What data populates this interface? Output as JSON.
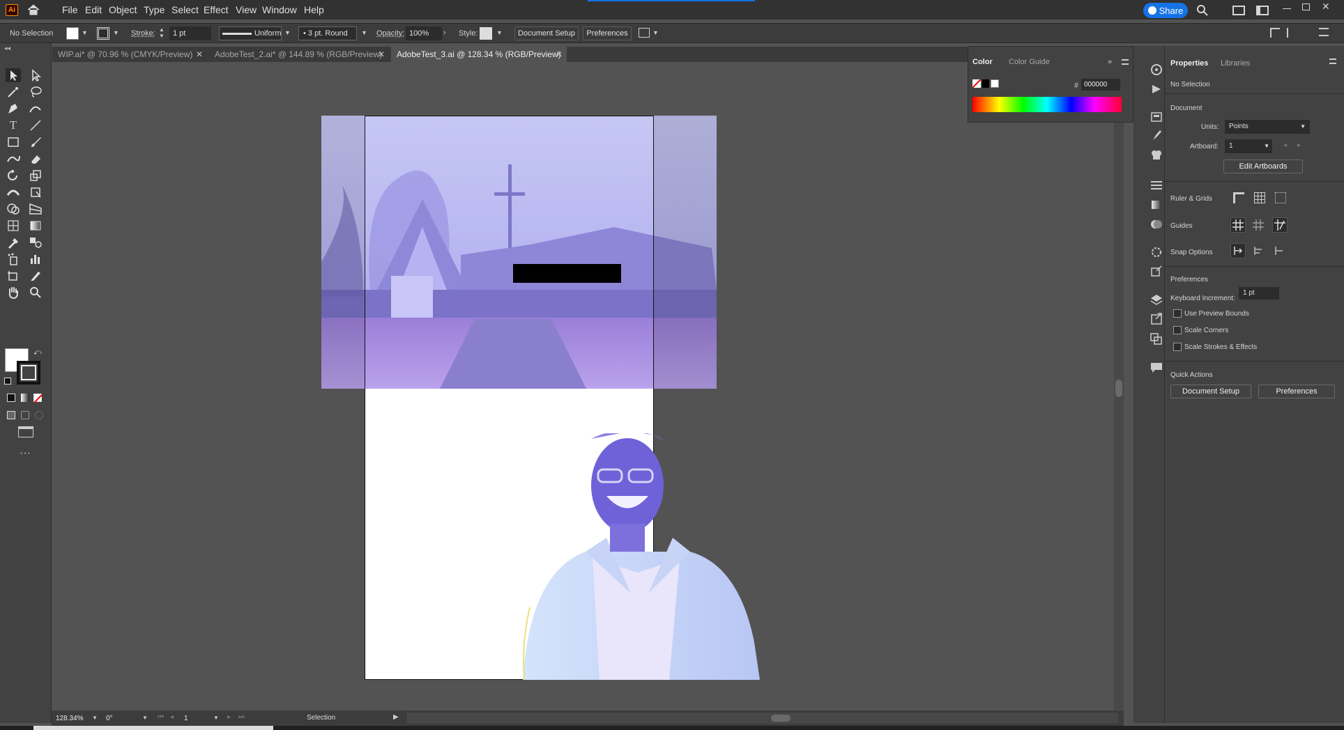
{
  "app": {
    "logo": "Ai",
    "share_label": "Share"
  },
  "menu": [
    "File",
    "Edit",
    "Object",
    "Type",
    "Select",
    "Effect",
    "View",
    "Window",
    "Help"
  ],
  "control_bar": {
    "selection": "No Selection",
    "stroke_label": "Stroke:",
    "stroke_value": "1 pt",
    "stroke_profile": "Uniform",
    "brush": "3 pt. Round",
    "opacity_label": "Opacity:",
    "opacity_value": "100%",
    "style_label": "Style:",
    "doc_setup": "Document Setup",
    "preferences": "Preferences"
  },
  "tabs": [
    {
      "label": "WIP.ai* @ 70.96 % (CMYK/Preview)",
      "active": false
    },
    {
      "label": "AdobeTest_2.ai* @ 144.89 % (RGB/Preview)",
      "active": false
    },
    {
      "label": "AdobeTest_3.ai @ 128.34 % (RGB/Preview)",
      "active": true
    }
  ],
  "color_panel": {
    "tabs": [
      "Color",
      "Color Guide"
    ],
    "hex_label": "#",
    "hex_value": "000000"
  },
  "properties": {
    "tabs": [
      "Properties",
      "Libraries"
    ],
    "no_selection": "No Selection",
    "document": "Document",
    "units_label": "Units:",
    "units_value": "Points",
    "artboard_label": "Artboard:",
    "artboard_value": "1",
    "edit_artboards": "Edit Artboards",
    "ruler_grids": "Ruler & Grids",
    "guides": "Guides",
    "snap_options": "Snap Options",
    "preferences": "Preferences",
    "keyboard_increment_label": "Keyboard Increment:",
    "keyboard_increment_value": "1 pt",
    "use_preview_bounds": "Use Preview Bounds",
    "scale_corners": "Scale Corners",
    "scale_strokes": "Scale Strokes & Effects",
    "quick_actions": "Quick Actions",
    "qa_doc_setup": "Document Setup",
    "qa_preferences": "Preferences"
  },
  "status": {
    "zoom": "128.34%",
    "rotation": "0°",
    "artboard": "1",
    "tool": "Selection"
  },
  "colors": {
    "accent": "#1473e6",
    "panel": "#424242",
    "canvas": "#535353"
  }
}
